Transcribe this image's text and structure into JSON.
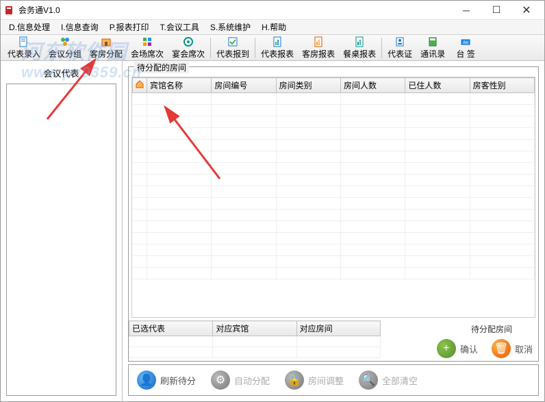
{
  "window": {
    "title": "会务通V1.0"
  },
  "menu": {
    "items": [
      "D.信息处理",
      "I.信息查询",
      "P.报表打印",
      "T.会议工具",
      "S.系统维护",
      "H.帮助"
    ]
  },
  "toolbar": {
    "items": [
      "代表录入",
      "会议分组",
      "客房分配",
      "会场席次",
      "宴会席次",
      "代表报到",
      "代表报表",
      "客房报表",
      "餐桌报表",
      "代表证",
      "通讯录",
      "台   签"
    ]
  },
  "leftPanel": {
    "title": "会议代表"
  },
  "mainSection": {
    "title": "待分配的房间",
    "columns": [
      "宾馆名称",
      "房间编号",
      "房间类别",
      "房间人数",
      "已住人数",
      "房客性别"
    ]
  },
  "subTable": {
    "columns": [
      "已选代表",
      "对应宾馆",
      "对应房间"
    ]
  },
  "actions": {
    "pendingLabel": "待分配房间",
    "confirm": "确认",
    "cancel": "取消"
  },
  "bottomActions": {
    "refresh": "刷新待分",
    "autoAssign": "自动分配",
    "roomAdjust": "房间调整",
    "clearAll": "全部清空"
  },
  "watermark": "河东软件园\nwww.pc0359.cn"
}
